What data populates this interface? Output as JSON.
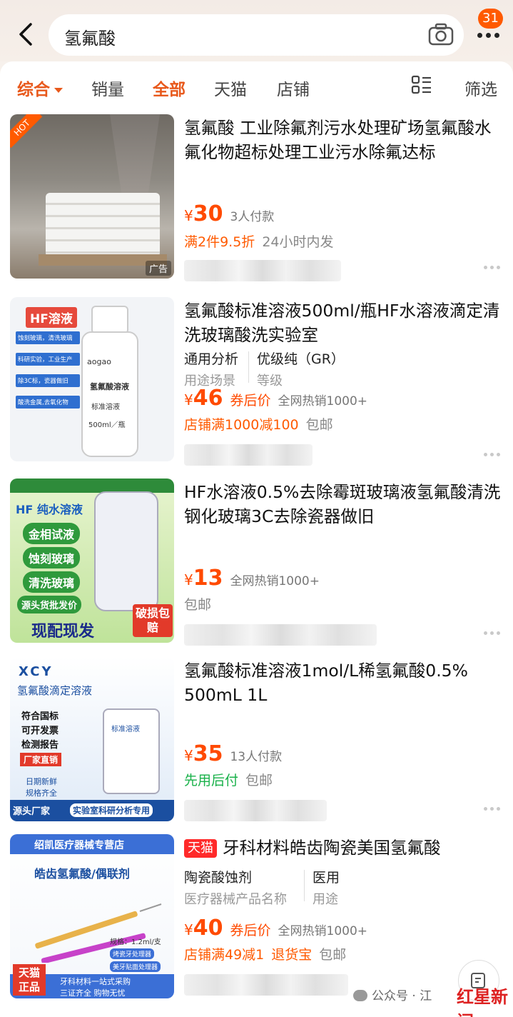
{
  "header": {
    "search_query": "氢氟酸",
    "badge_count": "31"
  },
  "filters": {
    "tabs": [
      "综合",
      "销量",
      "全部",
      "天猫",
      "店铺"
    ],
    "filter_label": "筛选"
  },
  "products": [
    {
      "title": "氢氟酸  工业除氟剂污水处理矿场氢氟酸水氟化物超标处理工业污水除氟达标",
      "hot_label": "HOT",
      "ad_label": "广告",
      "price": "30",
      "sales": "3人付款",
      "promo": "满2件9.5折",
      "promo_note": "24小时内发"
    },
    {
      "title": "氢氟酸标准溶液500ml/瓶HF水溶液滴定清洗玻璃酸洗实验室",
      "attr1_value": "通用分析",
      "attr1_label": "用途场景",
      "attr2_value": "优级纯（GR）",
      "attr2_label": "等级",
      "price": "46",
      "coupon": "券后价",
      "sales": "全网热销1000+",
      "promo": "店铺满1000减100",
      "promo_note": "包邮",
      "img_tag": "HF溶液",
      "img_brand": "aogao",
      "img_bottle": "氢氟酸溶液",
      "img_bottle2": "标准溶液",
      "img_bottle3": "500ml／瓶",
      "img_lines": [
        "蚀刻玻璃，清洗玻璃",
        "科研实验，工业生产",
        "除3C标，瓷器做旧",
        "酸洗金属,去氧化物"
      ]
    },
    {
      "title": "HF水溶液0.5%去除霉斑玻璃液氢氟酸清洗钢化玻璃3C去除瓷器做旧",
      "price": "13",
      "sales": "全网热销1000+",
      "promo_note": "包邮",
      "img_heading": "HF 纯水溶液",
      "img_buttons": [
        "金相试液",
        "蚀刻玻璃",
        "清洗玻璃",
        "源头货批发价"
      ],
      "img_bottom": "现配现发",
      "img_damage": "破损包赔"
    },
    {
      "title": "氢氟酸标准溶液1mol/L稀氢氟酸0.5% 500mL 1L",
      "price": "35",
      "sales": "13人付款",
      "promo_green": "先用后付",
      "promo_note": "包邮",
      "img_brand": "XCY",
      "img_heading": "氢氟酸滴定溶液",
      "img_lines": [
        "符合国标",
        "可开发票",
        "检测报告"
      ],
      "img_direct": "厂家直销",
      "img_fresh": "日期新鲜",
      "img_full": "规格齐全",
      "img_source": "源头厂家",
      "img_lab": "实验室科研分析专用",
      "img_bottle": "标准溶液"
    },
    {
      "tmall_tag": "天猫",
      "title": "牙科材料皓齿陶瓷美国氢氟酸",
      "attr1_value": "陶瓷酸蚀剂",
      "attr1_label": "医疗器械产品名称",
      "attr2_value": "医用",
      "attr2_label": "用途",
      "price": "40",
      "coupon": "券后价",
      "sales": "全网热销1000+",
      "promo": "店铺满49减1",
      "promo2": "退货宝",
      "promo_note": "包邮",
      "img_store": "绍凯医疗器械专营店",
      "img_heading": "皓齿氢氟酸/偶联剂",
      "img_spec": "规格：1.2ml/支",
      "img_chips": [
        "烤瓷牙处理器",
        "美牙贴面处理器"
      ],
      "img_tmall": "天猫正品",
      "img_footer": "牙科材料一站式采购",
      "img_footer2": "三证齐全  购物无忧"
    }
  ],
  "watermark": {
    "text": "公众号 · 江",
    "logo": "红星新闻"
  },
  "currency": "¥",
  "accent_color": "#ff5a00"
}
